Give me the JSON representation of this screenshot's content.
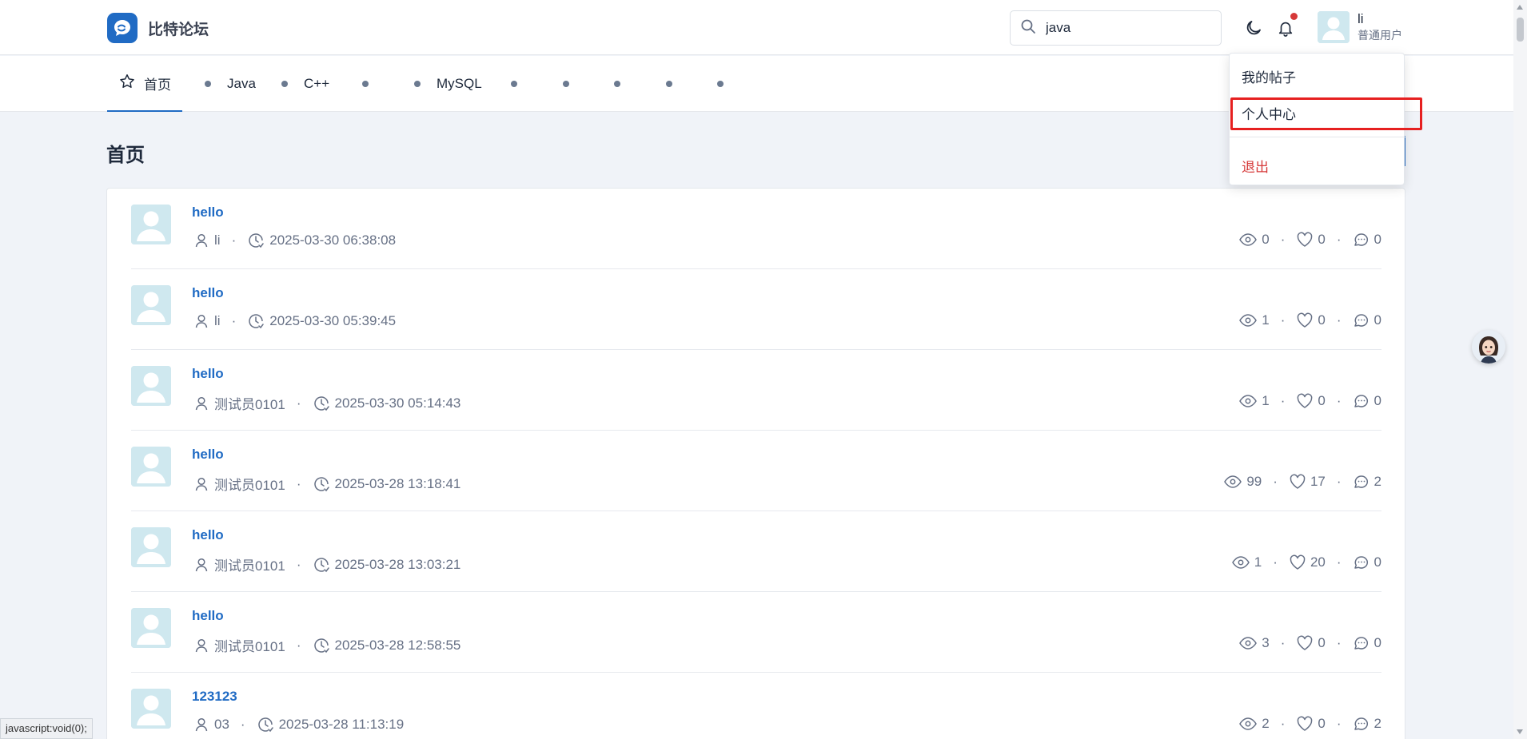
{
  "brand": {
    "name": "比特论坛",
    "logo_icon": "chat-logo-icon",
    "accent": "#206bc4"
  },
  "search": {
    "value": "java",
    "placeholder": "搜索"
  },
  "user": {
    "name": "li",
    "role": "普通用户"
  },
  "nav": {
    "home": "首页",
    "items": [
      "Java",
      "C++",
      "",
      "MySQL",
      "",
      "",
      "",
      "",
      ""
    ]
  },
  "page": {
    "title": "首页"
  },
  "posts": [
    {
      "title": "hello",
      "author": "li",
      "time": "2025-03-30 06:38:08",
      "views": "0",
      "likes": "0",
      "comments": "0"
    },
    {
      "title": "hello",
      "author": "li",
      "time": "2025-03-30 05:39:45",
      "views": "1",
      "likes": "0",
      "comments": "0"
    },
    {
      "title": "hello",
      "author": "测试员0101",
      "time": "2025-03-30 05:14:43",
      "views": "1",
      "likes": "0",
      "comments": "0"
    },
    {
      "title": "hello",
      "author": "测试员0101",
      "time": "2025-03-28 13:18:41",
      "views": "99",
      "likes": "17",
      "comments": "2"
    },
    {
      "title": "hello",
      "author": "测试员0101",
      "time": "2025-03-28 13:03:21",
      "views": "1",
      "likes": "20",
      "comments": "0"
    },
    {
      "title": "hello",
      "author": "测试员0101",
      "time": "2025-03-28 12:58:55",
      "views": "3",
      "likes": "0",
      "comments": "0"
    },
    {
      "title": "123123",
      "author": "03",
      "time": "2025-03-28 11:13:19",
      "views": "2",
      "likes": "0",
      "comments": "2"
    }
  ],
  "separator": "·",
  "dropdown": {
    "my_posts": "我的帖子",
    "profile": "个人中心",
    "logout": "退出"
  },
  "status_link": "javascript:void(0);",
  "colors": {
    "link": "#206bc4",
    "danger": "#d63939",
    "highlight": "#e62020",
    "muted": "#667085"
  }
}
